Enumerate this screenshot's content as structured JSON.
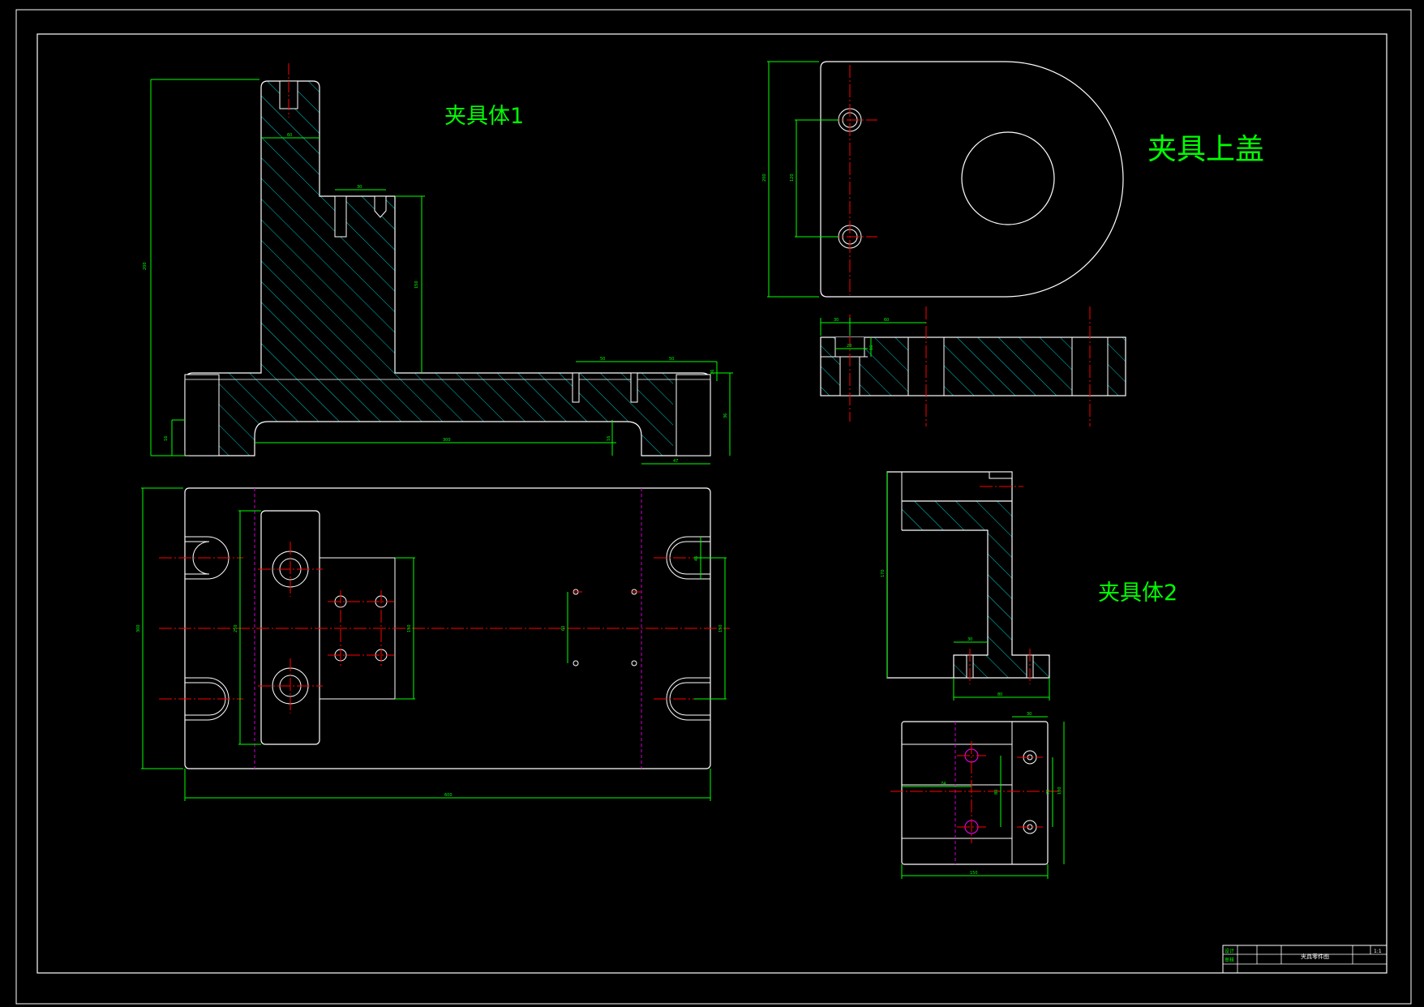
{
  "colors": {
    "background": "#000000",
    "outline": "#ffffff",
    "dimension": "#00ff00",
    "centerline": "#ff0000",
    "hatch": "#00cccc",
    "label": "#00ff00",
    "magenta_axis": "#cc00cc"
  },
  "views": {
    "body1": {
      "label": "夹具体1"
    },
    "cover": {
      "label": "夹具上盖"
    },
    "body2": {
      "label": "夹具体2"
    }
  },
  "dimensions": {
    "body1_height": "200",
    "body1_top_width": "60",
    "body1_hole_spacing": "30",
    "body1_step_height": "150",
    "body1_base_span": "300",
    "body1_left_gap": "16",
    "body1_right_gap": "16",
    "body1_pin_offset1": "50",
    "body1_pin_offset2": "50",
    "body1_base_right": "36",
    "body1_slot_width": "47",
    "body1_right_top": "36",
    "plan_height": "300",
    "plan_inner": "250",
    "plan_block": "150",
    "plan_pin_spacing": "60",
    "plan_right_slot": "45",
    "plan_right_height": "150",
    "plan_width": "600",
    "cover_height": "200",
    "cover_hole_spacing": "120",
    "cover_section_left": "30",
    "cover_section_mid": "60",
    "cover_section_small": "20",
    "cover_section_right": "16",
    "body2_height": "170",
    "body2_foot": "30",
    "body2_base": "80",
    "body2_top_width": "30",
    "body2_mid": "74",
    "body2_hole_span": "80",
    "body2_right_span": "70",
    "body2_right_outer": "100",
    "body2_bottom": "150"
  },
  "title_block": {
    "row1_label": "设计",
    "row2_label": "审核",
    "drawing_name": "夹具零件图",
    "scale": "1:1"
  }
}
